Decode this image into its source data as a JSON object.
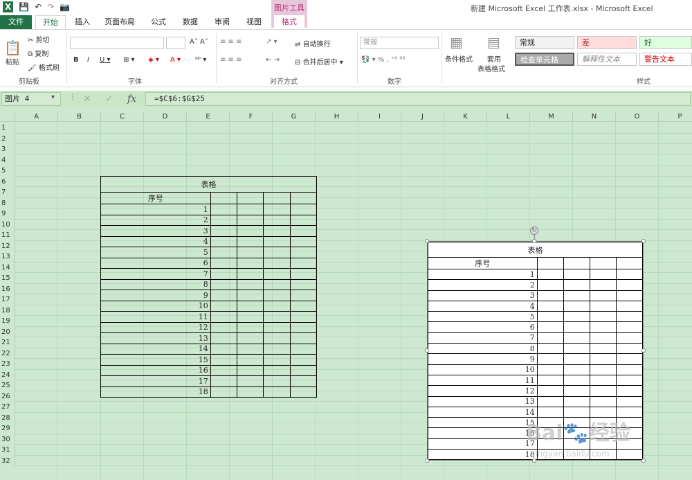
{
  "window_title": "新建 Microsoft Excel 工作表.xlsx - Microsoft Excel",
  "qat": {
    "save": "💾",
    "undo": "↶",
    "redo": "↷",
    "camera": "📷"
  },
  "tool_group_label": "图片工具",
  "tabs": {
    "file": "文件",
    "home": "开始",
    "insert": "插入",
    "page_layout": "页面布局",
    "formulas": "公式",
    "data": "数据",
    "review": "审阅",
    "view": "视图",
    "format": "格式"
  },
  "ribbon": {
    "paste": "粘贴",
    "cut": "剪切",
    "copy": "复制",
    "format_painter": "格式刷",
    "clipboard": "剪贴板",
    "font": "字体",
    "alignment": "对齐方式",
    "wrap": "自动换行",
    "merge": "合并后居中",
    "number_format": "常规",
    "number": "数字",
    "cond_format": "条件格式",
    "table_style_1": "套用",
    "table_style_2": "表格格式",
    "styles": "样式",
    "style_boxes": [
      "常规",
      "差",
      "好",
      "检查单元格",
      "解释性文本",
      "警告文本"
    ]
  },
  "formula_bar": {
    "name_box": "图片 4",
    "formula": "=$C$6:$G$25"
  },
  "columns": [
    "A",
    "B",
    "C",
    "D",
    "E",
    "F",
    "G",
    "H",
    "I",
    "J",
    "K",
    "L",
    "M",
    "N",
    "O",
    "P"
  ],
  "rows": [
    "1",
    "2",
    "3",
    "4",
    "5",
    "6",
    "7",
    "8",
    "9",
    "10",
    "11",
    "12",
    "13",
    "14",
    "15",
    "16",
    "17",
    "18",
    "19",
    "20",
    "21",
    "22",
    "23",
    "24",
    "25",
    "26",
    "27",
    "28",
    "29",
    "30",
    "31",
    "32"
  ],
  "table": {
    "title": "表格",
    "header": "序号",
    "numbers": [
      "1",
      "2",
      "3",
      "4",
      "5",
      "6",
      "7",
      "8",
      "9",
      "10",
      "11",
      "12",
      "13",
      "14",
      "15",
      "16",
      "17",
      "18"
    ]
  },
  "watermark": {
    "main": "Bai🐾经验",
    "sub": "jingyan.baidu.com"
  }
}
